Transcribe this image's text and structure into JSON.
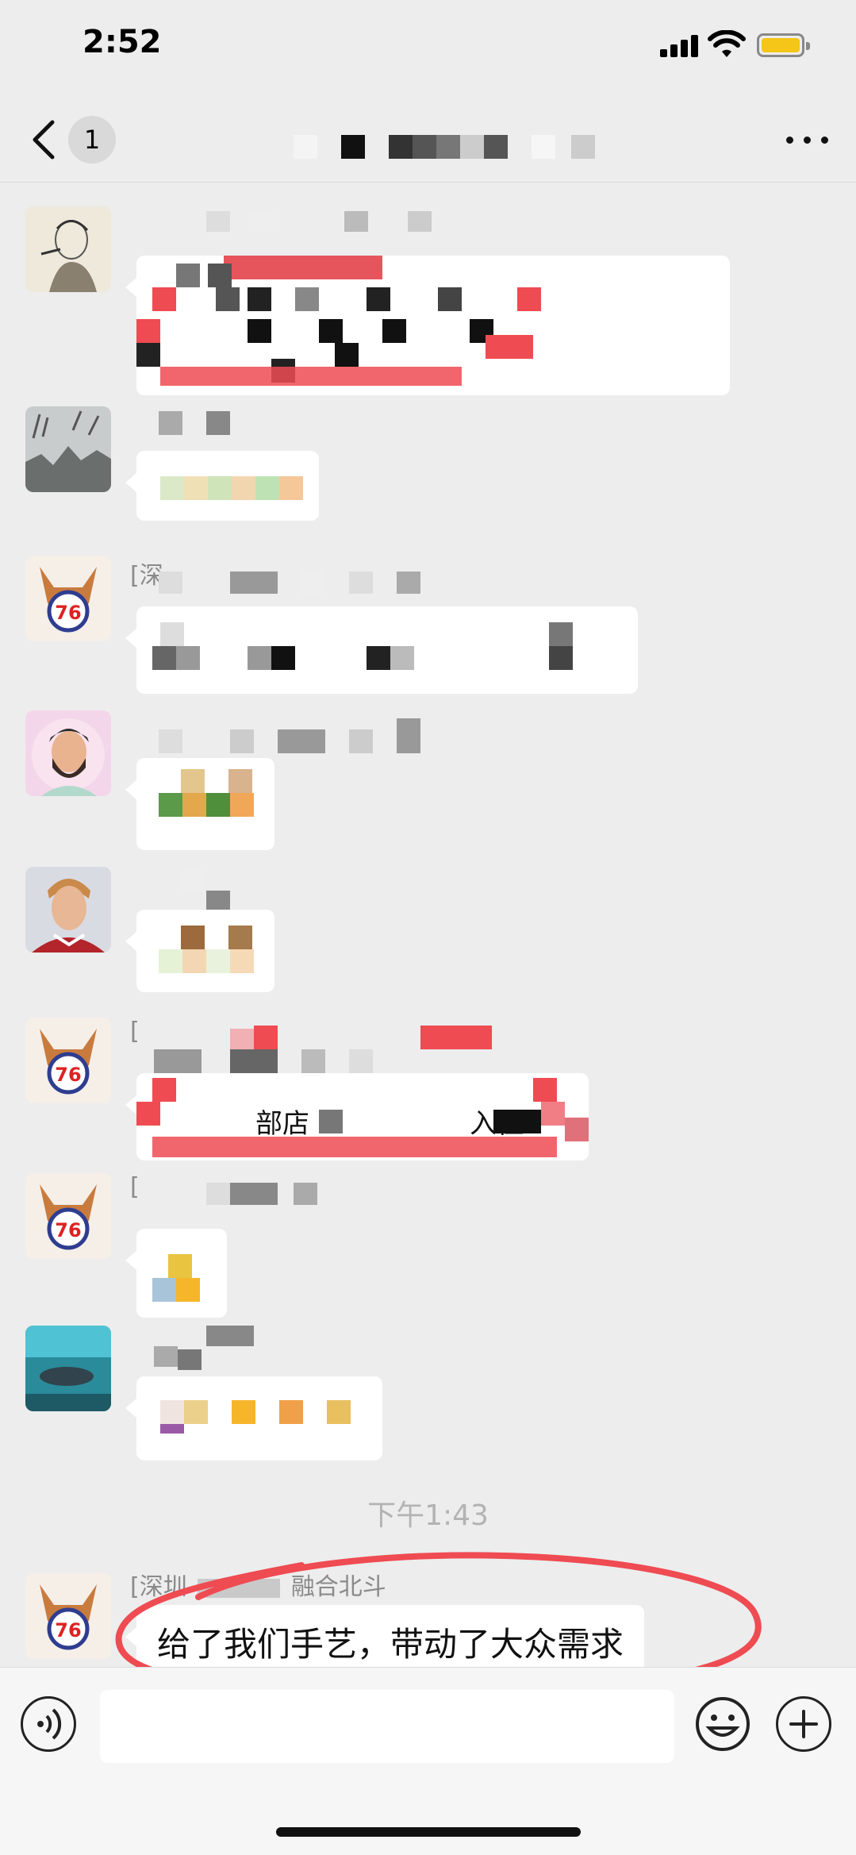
{
  "status_bar": {
    "time": "2:52"
  },
  "nav": {
    "unread_count": "1",
    "back_icon": "chevron-left-icon",
    "more_icon": "ellipsis-icon"
  },
  "messages": [
    {
      "sender": "",
      "avatar": "sketch-portrait",
      "content": "pixelated-image"
    },
    {
      "sender": "",
      "avatar": "winter-trees",
      "content": "pixelated-text"
    },
    {
      "sender": "[深",
      "avatar": "fox-76",
      "content": "pixelated-text"
    },
    {
      "sender": "",
      "avatar": "bearded-man",
      "content": "pixelated-emoji"
    },
    {
      "sender": "",
      "avatar": "football-player",
      "content": "pixelated-emoji"
    },
    {
      "sender": "[",
      "avatar": "fox-76",
      "content": "pixelated-text",
      "fragment_a": "部店",
      "fragment_b": "入住"
    },
    {
      "sender": "[",
      "avatar": "fox-76",
      "content": "pixelated-emoji"
    },
    {
      "sender": "",
      "avatar": "aquarium-fish",
      "content": "pixelated-emoji"
    }
  ],
  "time_divider": "下午1:43",
  "last_message": {
    "sender_prefix": "[深圳",
    "sender_suffix": "融合北斗",
    "text": "给了我们手艺，带动了大众需求",
    "avatar": "fox-76"
  },
  "input_bar": {
    "voice_icon": "voice-icon",
    "emoji_icon": "smiley-icon",
    "plus_icon": "plus-icon",
    "input_value": ""
  },
  "colors": {
    "background": "#ededed",
    "bubble": "#ffffff",
    "annotation_red": "#ef4b52",
    "battery": "#f5c518"
  }
}
